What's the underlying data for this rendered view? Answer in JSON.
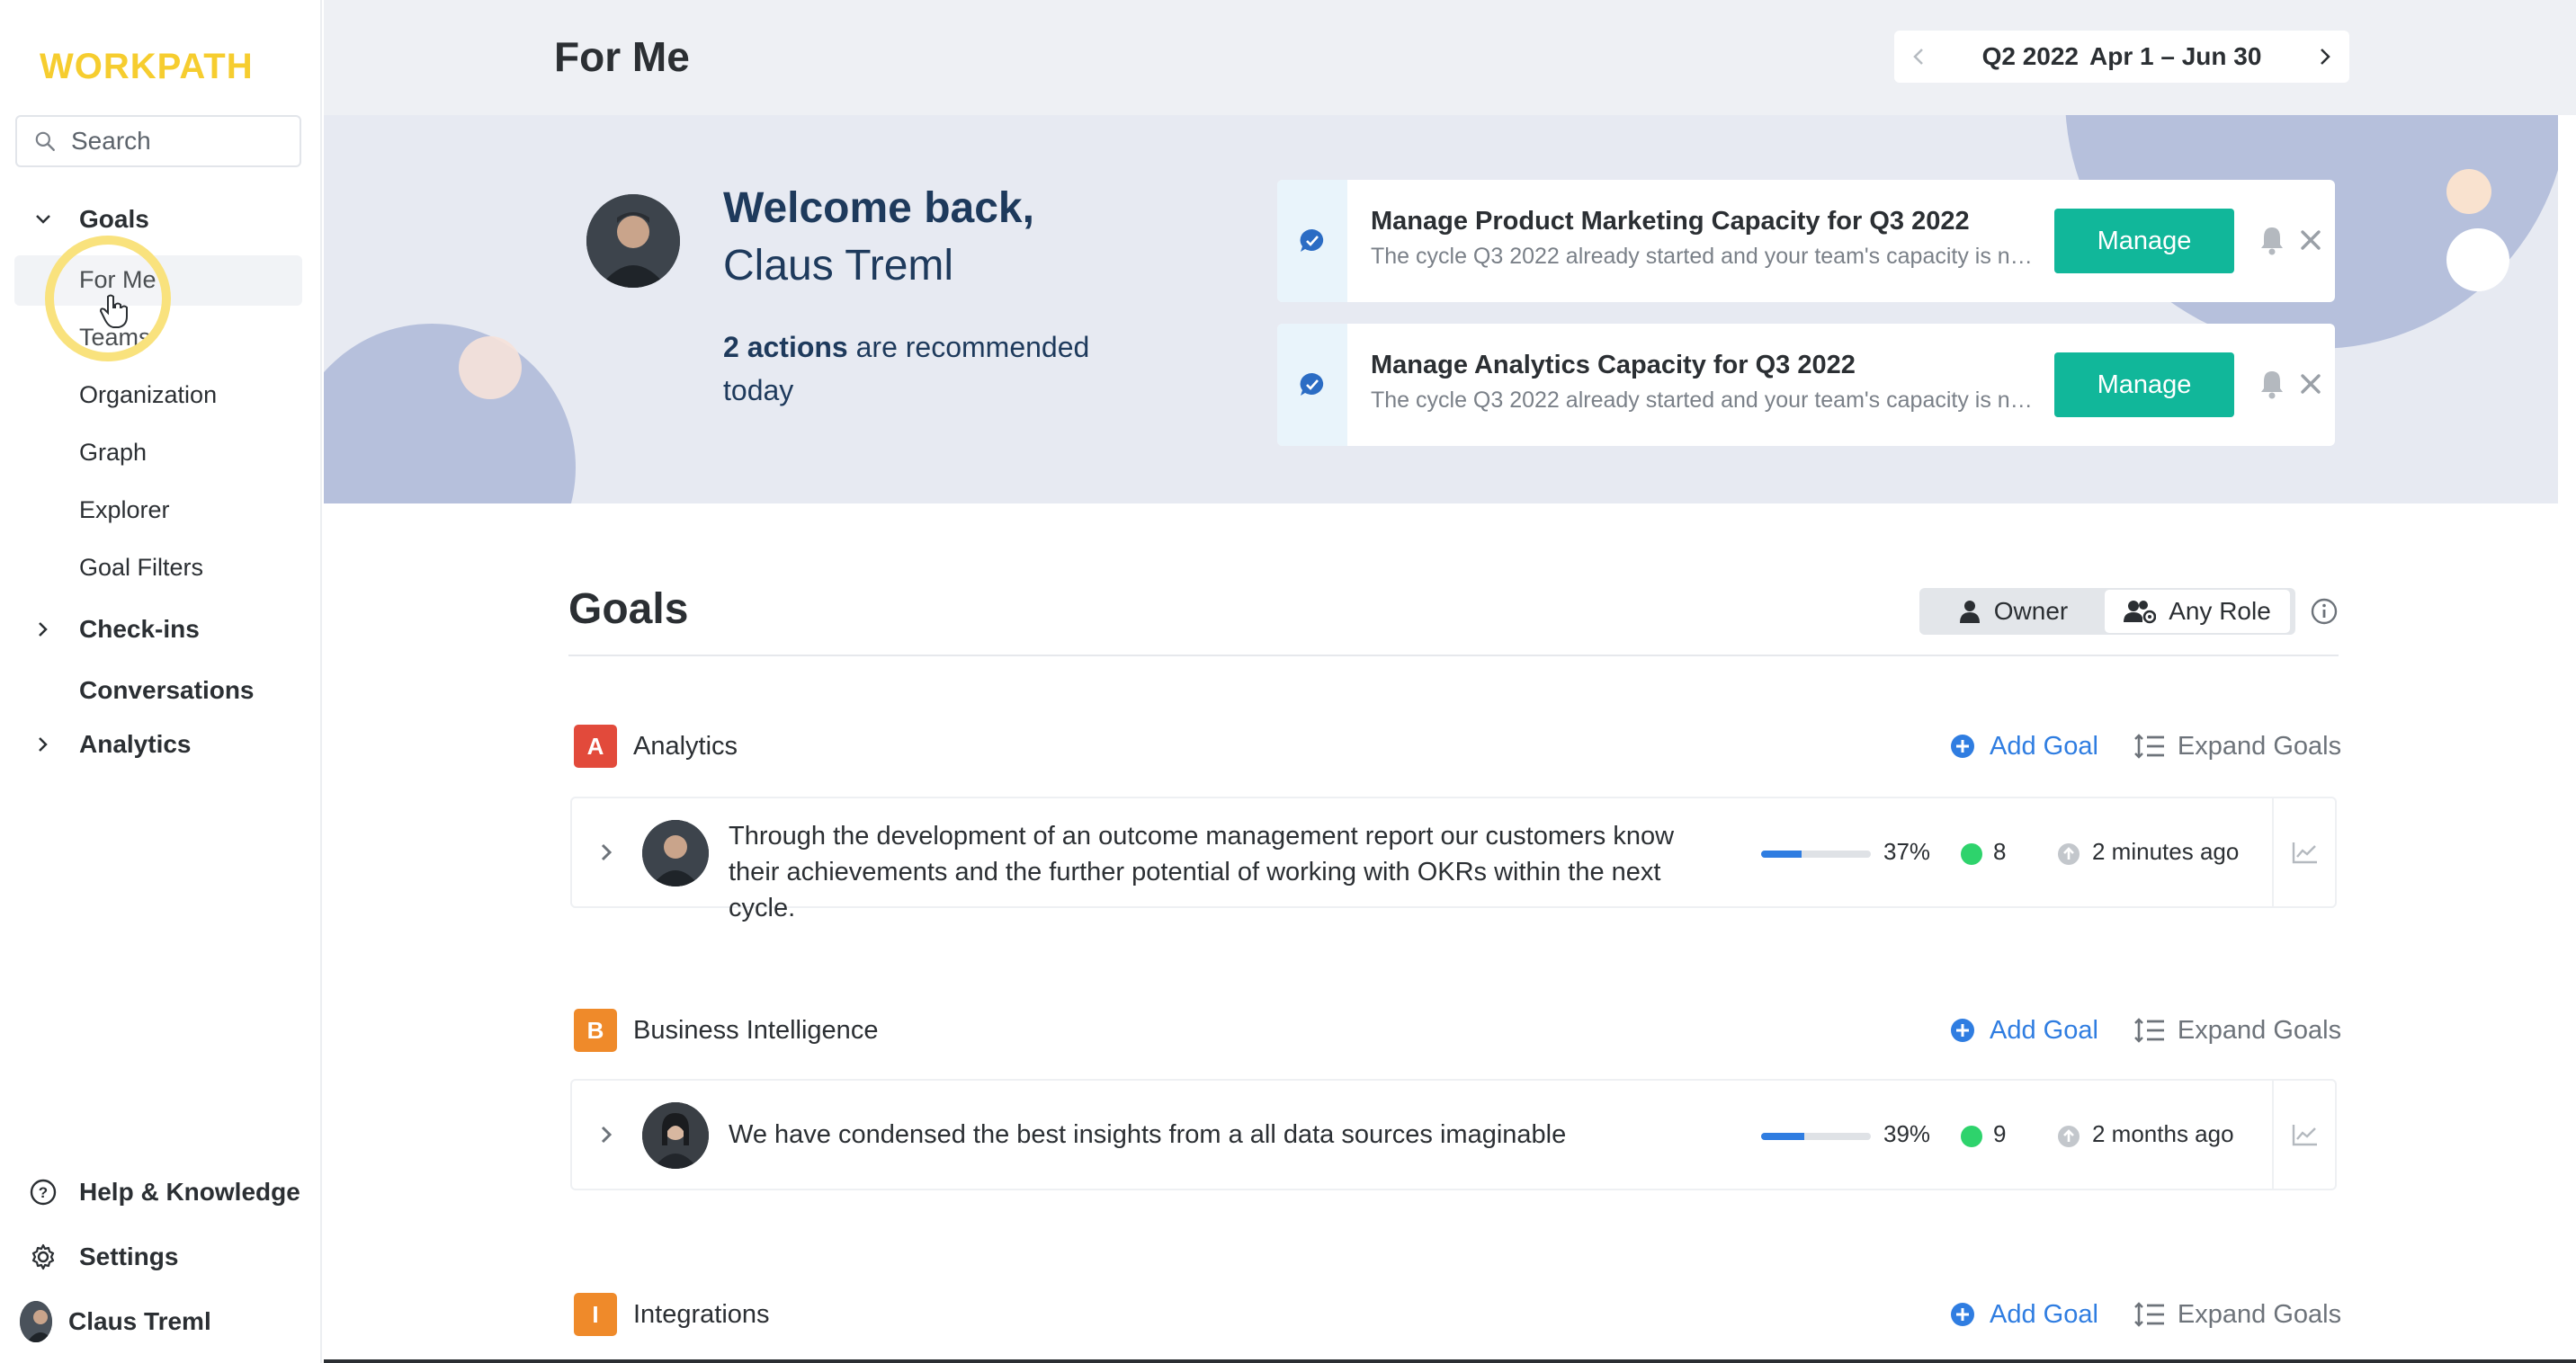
{
  "app": {
    "logo": "WORKPATH",
    "accent": "#f6cd2f"
  },
  "sidebar": {
    "search_placeholder": "Search",
    "groups": {
      "goals": {
        "label": "Goals",
        "items": [
          "For Me",
          "Teams",
          "Organization",
          "Graph",
          "Explorer",
          "Goal Filters"
        ],
        "active": "For Me"
      },
      "checkins": {
        "label": "Check-ins"
      },
      "conversations": {
        "label": "Conversations"
      },
      "analytics": {
        "label": "Analytics"
      }
    },
    "bottom": {
      "help": "Help & Knowledge",
      "settings": "Settings",
      "user": "Claus Treml"
    }
  },
  "header": {
    "title": "For Me",
    "period": {
      "quarter": "Q2 2022",
      "range": "Apr 1 – Jun 30"
    }
  },
  "hero": {
    "greeting": "Welcome back,",
    "name": "Claus Treml",
    "actions_count": "2 actions",
    "actions_text": "are recommended today",
    "actions": [
      {
        "title": "Manage Product Marketing Capacity for Q3 2022",
        "desc": "The cycle Q3 2022 already started and your team's capacity is not al...",
        "button": "Manage"
      },
      {
        "title": "Manage Analytics Capacity for Q3 2022",
        "desc": "The cycle Q3 2022 already started and your team's capacity is not al...",
        "button": "Manage"
      }
    ]
  },
  "goals": {
    "title": "Goals",
    "role_filter": {
      "owner": "Owner",
      "any": "Any Role",
      "selected": "Any Role"
    },
    "add_goal_label": "Add Goal",
    "expand_goals_label": "Expand Goals",
    "teams": [
      {
        "badge": "A",
        "badge_color": "#e24a3b",
        "name": "Analytics",
        "goal": {
          "text": "Through the development of an outcome management report our customers know their achievements and the further potential of working with OKRs within the next cycle.",
          "progress": 37,
          "progress_label": "37%",
          "key_results": "8",
          "updated": "2 minutes ago"
        }
      },
      {
        "badge": "B",
        "badge_color": "#ef8a2a",
        "name": "Business Intelligence",
        "goal": {
          "text": "We have condensed the best insights from a all data sources imaginable",
          "progress": 39,
          "progress_label": "39%",
          "key_results": "9",
          "updated": "2 months ago"
        }
      },
      {
        "badge": "I",
        "badge_color": "#ef8a2a",
        "name": "Integrations"
      }
    ]
  }
}
